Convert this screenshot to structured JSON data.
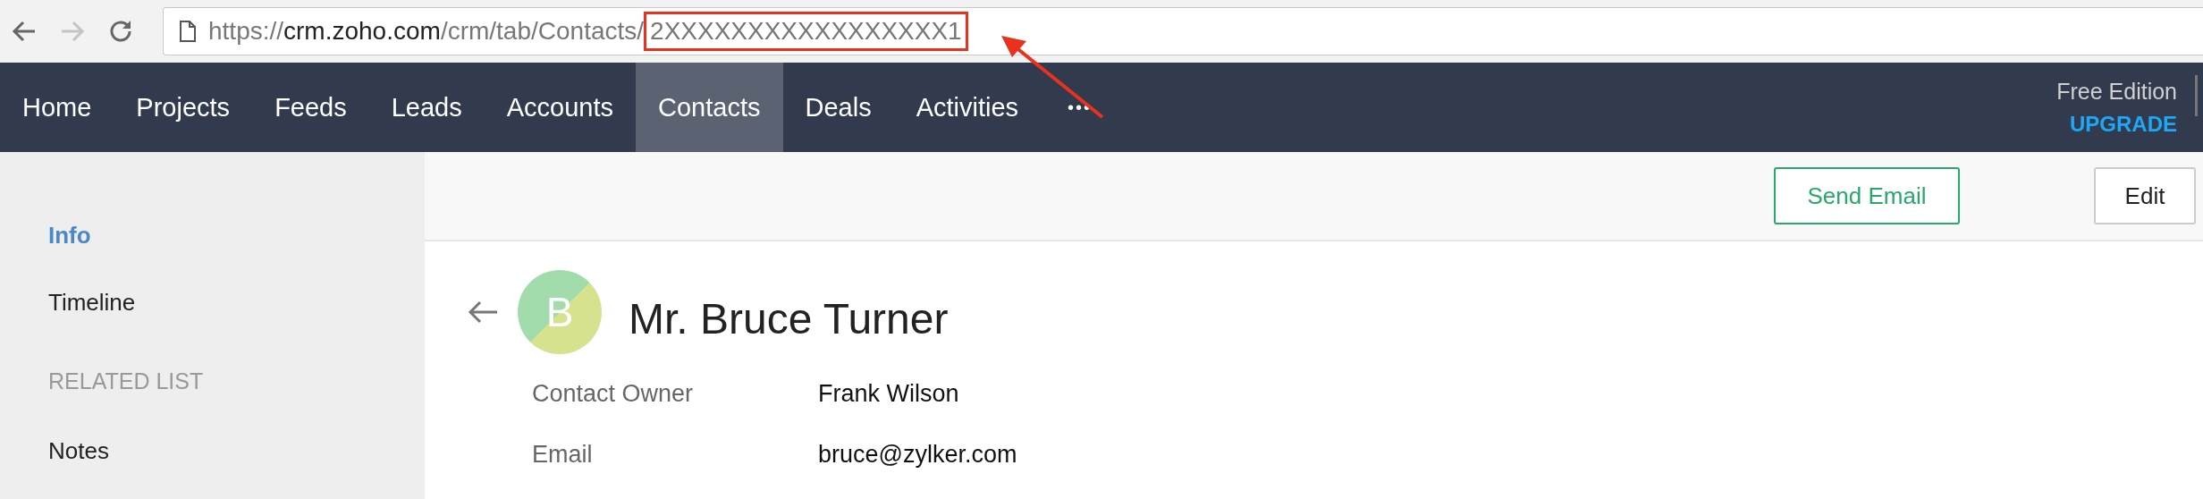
{
  "browser": {
    "back_disabled": false,
    "forward_disabled": true,
    "url": {
      "scheme": "https://",
      "host": "crm.zoho.com",
      "path": "/crm/tab/Contacts/",
      "id": "2XXXXXXXXXXXXXXXXX1",
      "id_highlighted": true
    }
  },
  "nav": {
    "tabs": [
      {
        "label": "Home",
        "selected": false
      },
      {
        "label": "Projects",
        "selected": false
      },
      {
        "label": "Feeds",
        "selected": false
      },
      {
        "label": "Leads",
        "selected": false
      },
      {
        "label": "Accounts",
        "selected": false
      },
      {
        "label": "Contacts",
        "selected": true
      },
      {
        "label": "Deals",
        "selected": false
      },
      {
        "label": "Activities",
        "selected": false
      }
    ],
    "more": "•••",
    "edition": "Free Edition",
    "upgrade": "UPGRADE"
  },
  "sidebar": {
    "items": [
      {
        "kind": "link",
        "label": "Info",
        "selected": true
      },
      {
        "kind": "link",
        "label": "Timeline",
        "selected": false
      },
      {
        "kind": "heading",
        "label": "RELATED LIST"
      },
      {
        "kind": "link",
        "label": "Notes",
        "selected": false
      }
    ]
  },
  "toolbar": {
    "buttons": [
      {
        "kind": "primary",
        "label": "Send Email"
      },
      {
        "kind": "default",
        "label": "Edit"
      }
    ]
  },
  "record": {
    "initial": "B",
    "name": "Mr. Bruce Turner",
    "fields": [
      {
        "label": "Contact Owner",
        "value": "Frank Wilson"
      },
      {
        "label": "Email",
        "value": "bruce@zylker.com"
      }
    ]
  }
}
